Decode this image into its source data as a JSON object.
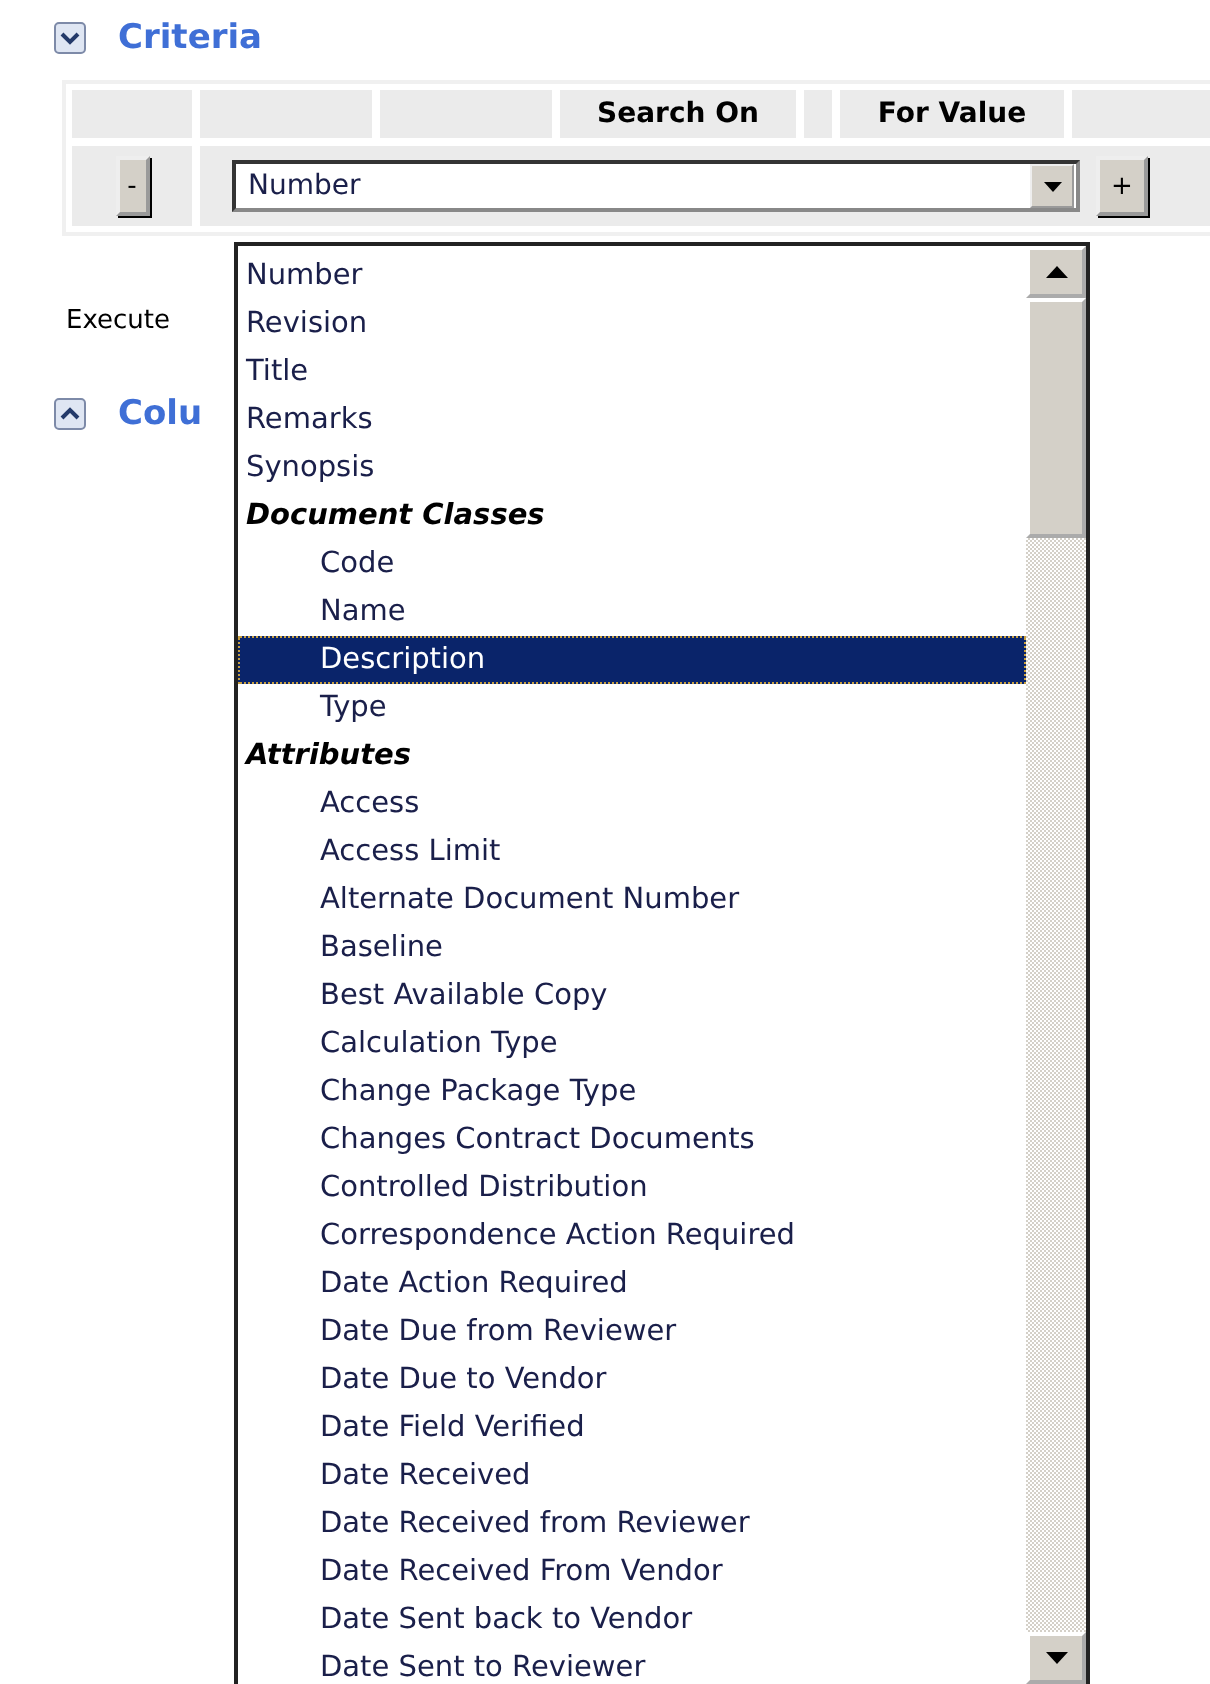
{
  "criteria": {
    "title": "Criteria",
    "expanded": true,
    "columns": [
      {
        "label": "Search On"
      },
      {
        "label": "For Value"
      }
    ],
    "remove_button": "-",
    "add_button": "+",
    "select": {
      "value": "Number"
    },
    "dropdown": [
      {
        "kind": "option",
        "label": "Number",
        "selected": false
      },
      {
        "kind": "option",
        "label": "Revision",
        "selected": false
      },
      {
        "kind": "option",
        "label": "Title",
        "selected": false
      },
      {
        "kind": "option",
        "label": "Remarks",
        "selected": false
      },
      {
        "kind": "option",
        "label": "Synopsis",
        "selected": false
      },
      {
        "kind": "group",
        "label": "Document Classes",
        "children": [
          {
            "label": "Code",
            "selected": false
          },
          {
            "label": "Name",
            "selected": false
          },
          {
            "label": "Description",
            "selected": true
          },
          {
            "label": "Type",
            "selected": false
          }
        ]
      },
      {
        "kind": "group",
        "label": "Attributes",
        "children": [
          {
            "label": "Access",
            "selected": false
          },
          {
            "label": "Access Limit",
            "selected": false
          },
          {
            "label": "Alternate Document Number",
            "selected": false
          },
          {
            "label": "Baseline",
            "selected": false
          },
          {
            "label": "Best Available Copy",
            "selected": false
          },
          {
            "label": "Calculation Type",
            "selected": false
          },
          {
            "label": "Change Package Type",
            "selected": false
          },
          {
            "label": "Changes Contract Documents",
            "selected": false
          },
          {
            "label": "Controlled Distribution",
            "selected": false
          },
          {
            "label": "Correspondence Action Required",
            "selected": false
          },
          {
            "label": "Date Action Required",
            "selected": false
          },
          {
            "label": "Date Due from Reviewer",
            "selected": false
          },
          {
            "label": "Date Due to Vendor",
            "selected": false
          },
          {
            "label": "Date Field Verified",
            "selected": false
          },
          {
            "label": "Date Received",
            "selected": false
          },
          {
            "label": "Date Received from Reviewer",
            "selected": false
          },
          {
            "label": "Date Received From Vendor",
            "selected": false
          },
          {
            "label": "Date Sent back to Vendor",
            "selected": false
          },
          {
            "label": "Date Sent to Reviewer",
            "selected": false
          }
        ]
      }
    ]
  },
  "execute_text": "Execute",
  "columns_section": {
    "title": "Colu",
    "expanded": false
  }
}
